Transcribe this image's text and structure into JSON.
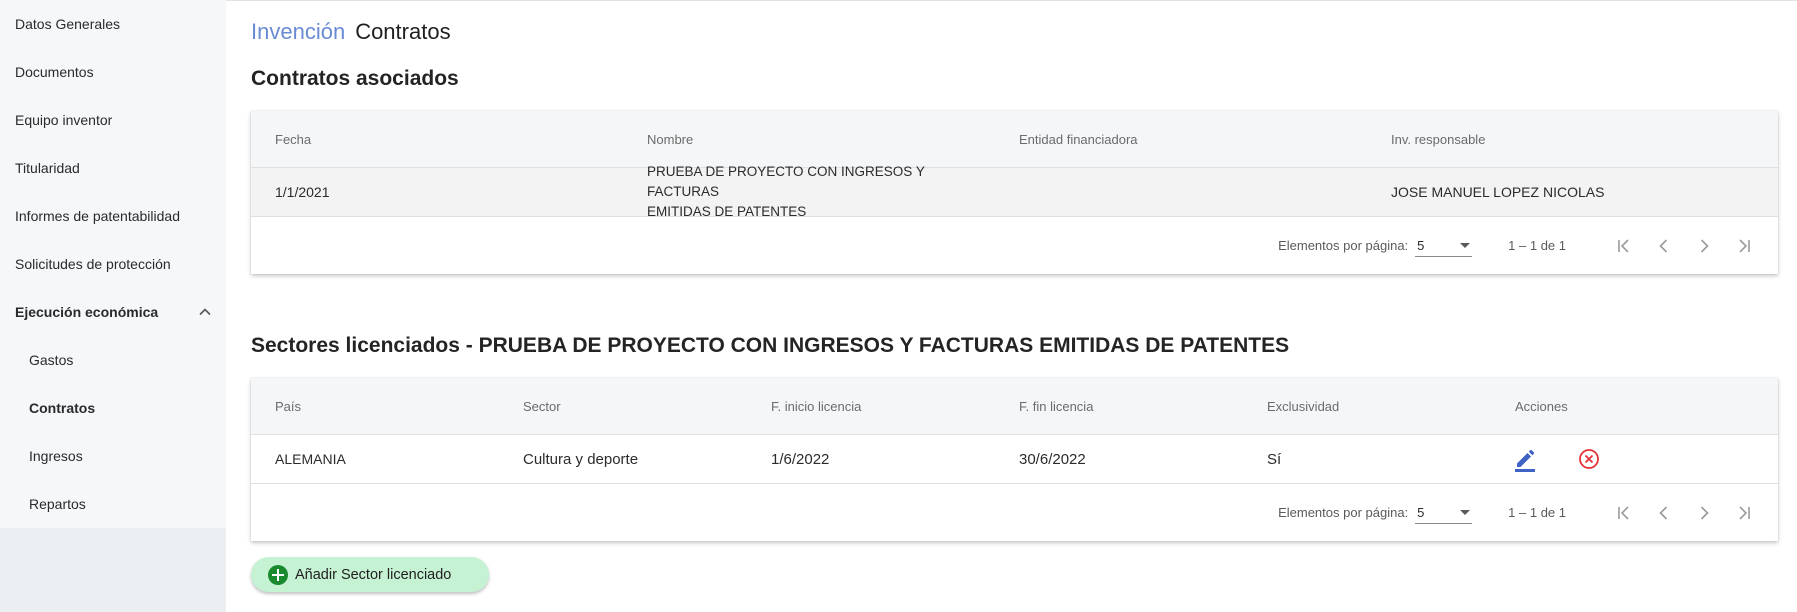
{
  "sidebar": {
    "items": [
      {
        "label": "Datos Generales"
      },
      {
        "label": "Documentos"
      },
      {
        "label": "Equipo inventor"
      },
      {
        "label": "Titularidad"
      },
      {
        "label": "Informes de patentabilidad"
      },
      {
        "label": "Solicitudes de protección"
      },
      {
        "label": "Ejecución económica",
        "expanded": true
      },
      {
        "label": "Gastos"
      },
      {
        "label": "Contratos",
        "active": true
      },
      {
        "label": "Ingresos"
      },
      {
        "label": "Repartos"
      }
    ]
  },
  "breadcrumb": {
    "parent": "Invención",
    "current": "Contratos"
  },
  "contratos": {
    "title": "Contratos asociados",
    "columns": [
      "Fecha",
      "Nombre",
      "Entidad financiadora",
      "Inv. responsable"
    ],
    "rows": [
      {
        "fecha": "1/1/2021",
        "nombre_line1": "PRUEBA DE PROYECTO CON INGRESOS Y FACTURAS",
        "nombre_line2": "EMITIDAS DE PATENTES",
        "entidad": "",
        "responsable": "JOSE MANUEL LOPEZ NICOLAS"
      }
    ],
    "paginator": {
      "label": "Elementos por página:",
      "page_size": "5",
      "range": "1 – 1 de 1"
    }
  },
  "sectores": {
    "title": "Sectores licenciados - PRUEBA DE PROYECTO CON INGRESOS Y FACTURAS EMITIDAS DE PATENTES",
    "columns": [
      "País",
      "Sector",
      "F. inicio licencia",
      "F. fin licencia",
      "Exclusividad",
      "Acciones"
    ],
    "rows": [
      {
        "pais": "ALEMANIA",
        "sector": "Cultura y deporte",
        "inicio": "1/6/2022",
        "fin": "30/6/2022",
        "exclusividad": "Sí"
      }
    ],
    "paginator": {
      "label": "Elementos por página:",
      "page_size": "5",
      "range": "1 – 1 de 1"
    }
  },
  "add_button": {
    "label": "Añadir Sector licenciado"
  },
  "colors": {
    "accent": "#6a8bd4",
    "edit_icon": "#3f63c4",
    "delete_icon": "#e5323a",
    "add_button_bg": "#c6f2d4",
    "add_icon": "#198a2e"
  },
  "icons": {
    "expand": "chevron-up-icon",
    "edit": "pencil-icon",
    "delete": "close-circle-icon",
    "add": "plus-circle-icon",
    "first": "first-page-icon",
    "prev": "chevron-left-icon",
    "next": "chevron-right-icon",
    "last": "last-page-icon"
  }
}
